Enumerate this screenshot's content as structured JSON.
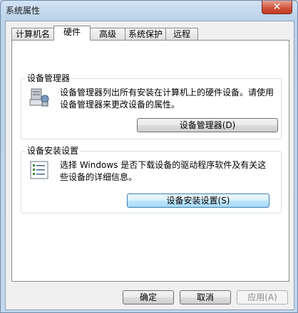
{
  "window": {
    "title": "系统属性",
    "close_glyph": "✕"
  },
  "tabs": [
    {
      "label": "计算机名",
      "active": false
    },
    {
      "label": "硬件",
      "active": true
    },
    {
      "label": "高级",
      "active": false
    },
    {
      "label": "系统保护",
      "active": false
    },
    {
      "label": "远程",
      "active": false
    }
  ],
  "device_manager": {
    "title": "设备管理器",
    "description": "设备管理器列出所有安装在计算机上的硬件设备。请使用设备管理器来更改设备的属性。",
    "button_label": "设备管理器(D)",
    "icon": "device-manager-icon"
  },
  "device_install": {
    "title": "设备安装设置",
    "description": "选择 Windows 是否下载设备的驱动程序软件及有关这些设备的详细信息。",
    "button_label": "设备安装设置(S)",
    "icon": "checklist-icon"
  },
  "footer": {
    "ok_label": "确定",
    "cancel_label": "取消",
    "apply_label": "应用(A)"
  }
}
